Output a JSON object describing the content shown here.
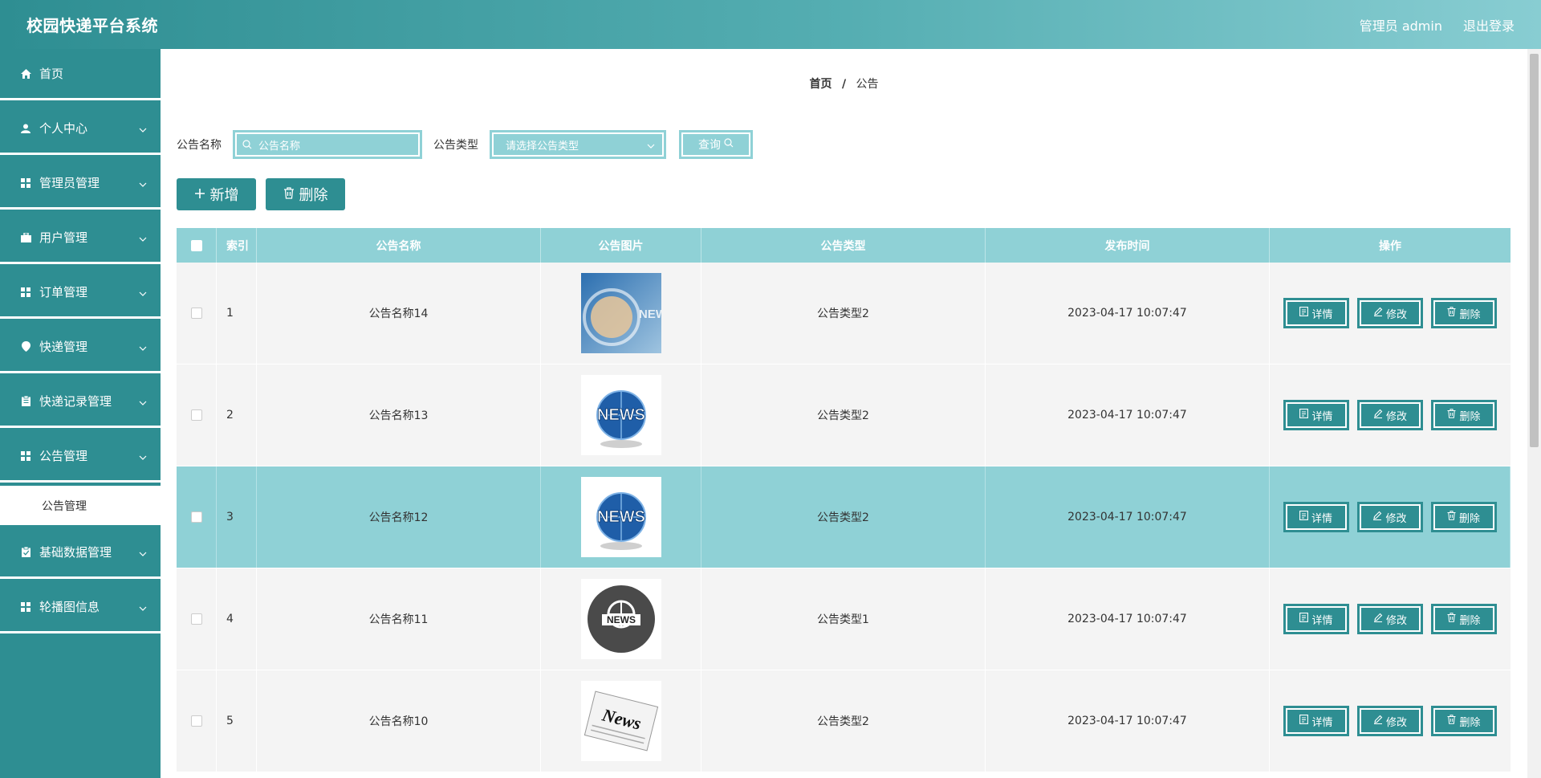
{
  "header": {
    "title": "校园快递平台系统",
    "user_label": "管理员 admin",
    "logout_label": "退出登录"
  },
  "sidebar": {
    "items": [
      {
        "label": "首页",
        "icon": "home-icon",
        "has_children": false
      },
      {
        "label": "个人中心",
        "icon": "user-icon",
        "has_children": true
      },
      {
        "label": "管理员管理",
        "icon": "grid-icon",
        "has_children": true
      },
      {
        "label": "用户管理",
        "icon": "briefcase-icon",
        "has_children": true
      },
      {
        "label": "订单管理",
        "icon": "grid-icon",
        "has_children": true
      },
      {
        "label": "快递管理",
        "icon": "location-pin-icon",
        "has_children": true
      },
      {
        "label": "快递记录管理",
        "icon": "clipboard-icon",
        "has_children": true
      },
      {
        "label": "公告管理",
        "icon": "grid-icon",
        "has_children": true
      },
      {
        "label": "基础数据管理",
        "icon": "clipboard-check-icon",
        "has_children": true
      },
      {
        "label": "轮播图信息",
        "icon": "grid-icon",
        "has_children": true
      }
    ],
    "submenu": {
      "label": "公告管理"
    }
  },
  "breadcrumb": {
    "home": "首页",
    "sep": "/",
    "current": "公告"
  },
  "search": {
    "name_label": "公告名称",
    "name_placeholder": "公告名称",
    "type_label": "公告类型",
    "type_placeholder": "请选择公告类型",
    "query_label": "查询"
  },
  "actions": {
    "add_label": "新增",
    "delete_label": "删除"
  },
  "table": {
    "headers": {
      "index": "索引",
      "name": "公告名称",
      "image": "公告图片",
      "type": "公告类型",
      "time": "发布时间",
      "ops": "操作"
    },
    "op_labels": {
      "detail": "详情",
      "edit": "修改",
      "delete": "删除"
    },
    "rows": [
      {
        "index": "1",
        "name": "公告名称14",
        "image": "news-globe-blue",
        "type": "公告类型2",
        "time": "2023-04-17 10:07:47"
      },
      {
        "index": "2",
        "name": "公告名称13",
        "image": "news-globe",
        "type": "公告类型2",
        "time": "2023-04-17 10:07:47"
      },
      {
        "index": "3",
        "name": "公告名称12",
        "image": "news-globe",
        "type": "公告类型2",
        "time": "2023-04-17 10:07:47",
        "selected": true
      },
      {
        "index": "4",
        "name": "公告名称11",
        "image": "news-circle-dark",
        "type": "公告类型1",
        "time": "2023-04-17 10:07:47"
      },
      {
        "index": "5",
        "name": "公告名称10",
        "image": "news-paper",
        "type": "公告类型2",
        "time": "2023-04-17 10:07:47"
      }
    ]
  },
  "colors": {
    "primary": "#2e8e92",
    "light": "#8fd1d6",
    "row_bg": "#f4f4f4"
  }
}
